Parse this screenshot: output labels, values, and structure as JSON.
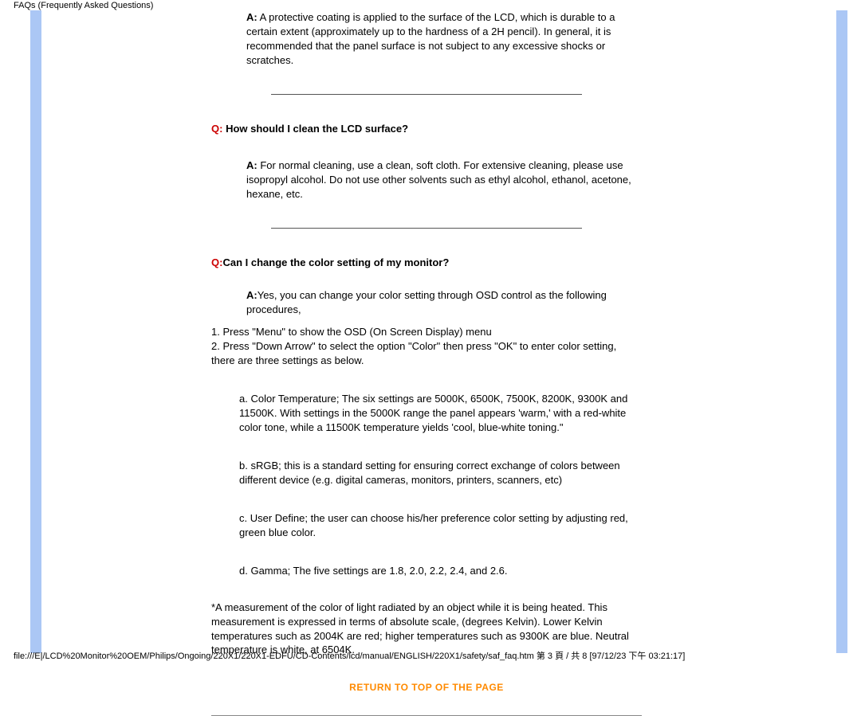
{
  "header": {
    "title": "FAQs (Frequently Asked Questions)"
  },
  "faq1": {
    "a_prefix": "A:",
    "a_text": " A protective coating is applied to the surface of the LCD, which is durable to a certain extent (approximately up to the hardness of a 2H pencil). In general, it is recommended that the panel surface is not subject to any excessive shocks or scratches."
  },
  "faq2": {
    "q_prefix": "Q:",
    "q_text": " How should I clean the LCD surface?",
    "a_prefix": "A:",
    "a_text": " For normal cleaning, use a clean, soft cloth. For extensive cleaning, please use isopropyl alcohol. Do not use other solvents such as ethyl alcohol, ethanol, acetone, hexane, etc."
  },
  "faq3": {
    "q_prefix": "Q:",
    "q_text": "Can I change the color setting of my monitor?",
    "a_prefix": "A:",
    "a_text": "Yes, you can change your color setting through OSD control as the following procedures,",
    "step1": "1. Press \"Menu\" to show the OSD (On Screen Display) menu",
    "step2": "2. Press \"Down Arrow\" to select the option \"Color\" then press \"OK\" to enter color setting, there are three settings as below.",
    "opt_a": "a. Color Temperature; The six settings are  5000K, 6500K, 7500K, 8200K, 9300K and 11500K. With settings in the 5000K range the panel appears 'warm,' with a red-white color tone, while a 11500K temperature yields 'cool, blue-white toning.\"",
    "opt_b": "b. sRGB; this is a standard setting for ensuring correct exchange of colors between different device (e.g. digital cameras, monitors, printers, scanners, etc)",
    "opt_c": "c. User Define; the user can choose his/her preference color setting by adjusting red, green blue color.",
    "opt_d": "d. Gamma; The five settings are 1.8, 2.0, 2.2, 2.4, and 2.6.",
    "footnote": "*A measurement of the color of light radiated by an object while it is being heated. This measurement is expressed in terms of absolute scale, (degrees Kelvin). Lower Kelvin temperatures such as 2004K are red; higher temperatures such as 9300K are blue. Neutral temperature is white, at 6504K."
  },
  "return_link": "RETURN TO TOP OF THE PAGE",
  "footer": {
    "path": "file:///E|/LCD%20Monitor%20OEM/Philips/Ongoing/220X1/220X1-EDFU/CD-Contents/lcd/manual/ENGLISH/220X1/safety/saf_faq.htm 第 3 頁 / 共 8  [97/12/23 下午 03:21:17]"
  }
}
